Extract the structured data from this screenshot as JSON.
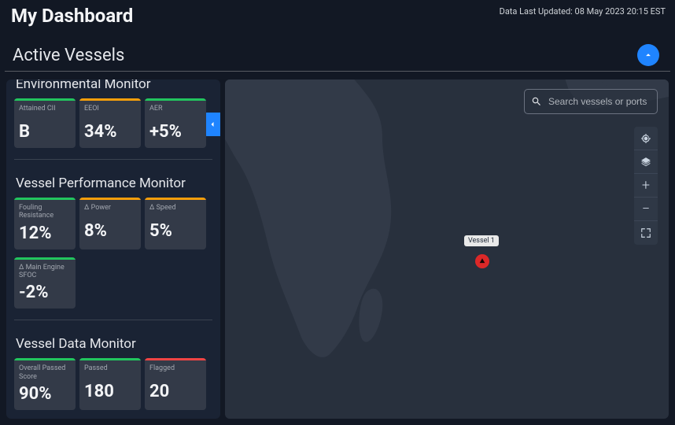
{
  "header": {
    "title": "My Dashboard",
    "last_updated": "Data Last Updated: 08 May 2023 20:15 EST"
  },
  "section": {
    "title": "Active Vessels"
  },
  "panels": {
    "environmental": {
      "title": "Environmental Monitor",
      "cards": [
        {
          "label": "Attained CII",
          "value": "B",
          "bar": "green"
        },
        {
          "label": "EEOI",
          "value": "34%",
          "bar": "orange"
        },
        {
          "label": "AER",
          "value": "+5%",
          "bar": "green"
        }
      ]
    },
    "performance": {
      "title": "Vessel Performance Monitor",
      "cards": [
        {
          "label": "Fouling Resistance",
          "value": "12%",
          "bar": "green"
        },
        {
          "label": "Δ Power",
          "value": "8%",
          "bar": "orange"
        },
        {
          "label": "Δ  Speed",
          "value": "5%",
          "bar": "orange"
        },
        {
          "label": "Δ Main Engine SFOC",
          "value": "-2%",
          "bar": "green"
        }
      ]
    },
    "data": {
      "title": "Vessel Data Monitor",
      "cards": [
        {
          "label": "Overall Passed Score",
          "value": "90%",
          "bar": "green"
        },
        {
          "label": "Passed",
          "value": "180",
          "bar": "green"
        },
        {
          "label": "Flagged",
          "value": "20",
          "bar": "red"
        }
      ]
    }
  },
  "search": {
    "placeholder": "Search vessels or ports"
  },
  "map": {
    "vessel_label": "Vessel 1"
  }
}
